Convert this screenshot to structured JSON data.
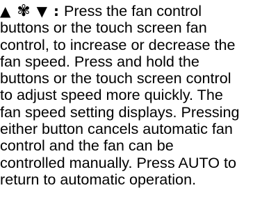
{
  "symbols": {
    "up": "▲",
    "fan": "✾",
    "down": "▼",
    "colon": ":"
  },
  "lines": [
    " Press the fan control",
    "buttons or the touch screen fan",
    "control, to increase or decrease the",
    "fan speed. Press and hold the",
    "buttons or the touch screen control",
    "to adjust speed more quickly. The",
    "fan speed setting displays. Pressing",
    "either button cancels automatic fan",
    "control and the fan can be",
    "controlled manually. Press AUTO to",
    "return to automatic operation."
  ]
}
